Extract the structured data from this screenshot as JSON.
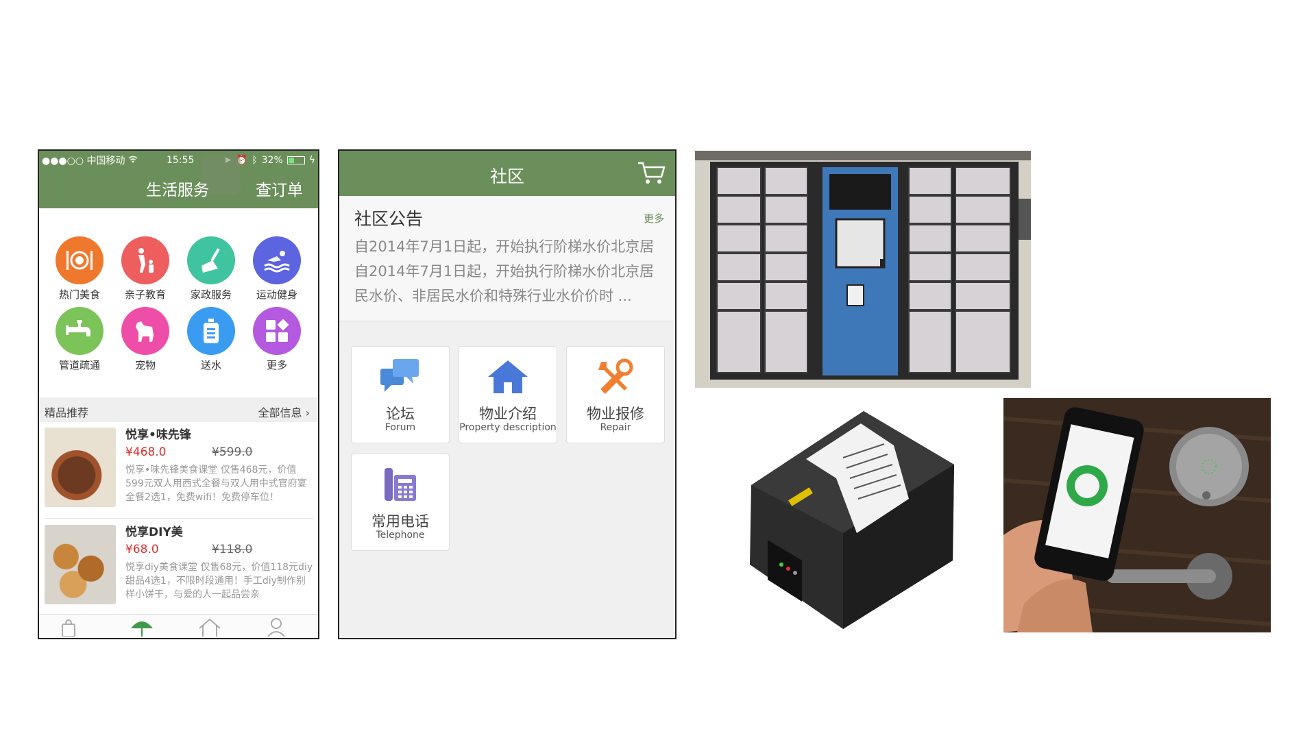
{
  "phone1": {
    "status": {
      "carrier": "●●●○○ 中国移动",
      "time": "15:55",
      "battery": "32%"
    },
    "header": {
      "title": "生活服务",
      "orders": "查订单"
    },
    "services": [
      {
        "label": "热门美食",
        "icon": "food-icon",
        "color": "#f0782c"
      },
      {
        "label": "亲子教育",
        "icon": "parent-child-icon",
        "color": "#ef5e5e"
      },
      {
        "label": "家政服务",
        "icon": "broom-icon",
        "color": "#40c4a0"
      },
      {
        "label": "运动健身",
        "icon": "swim-icon",
        "color": "#5d64e0"
      },
      {
        "label": "管道疏通",
        "icon": "faucet-icon",
        "color": "#7cc45a"
      },
      {
        "label": "宠物",
        "icon": "dog-icon",
        "color": "#ee4ea8"
      },
      {
        "label": "送水",
        "icon": "water-bottle-icon",
        "color": "#3a9cf0"
      },
      {
        "label": "更多",
        "icon": "more-grid-icon",
        "color": "#b45ae0"
      }
    ],
    "recommend": {
      "title": "精品推荐",
      "more": "全部信息"
    },
    "products": [
      {
        "name": "悦享•味先锋",
        "price": "¥468.0",
        "old_price": "¥599.0",
        "desc": "悦享•味先锋美食课堂 仅售468元，价值599元双人用西式全餐与双人用中式官府宴全餐2选1，免费wifi！免费停车位！"
      },
      {
        "name": "悦享DIY美",
        "price": "¥68.0",
        "old_price": "¥118.0",
        "desc": "悦享diy美食课堂 仅售68元，价值118元diy甜品4选1，不限时段通用！手工diy制作别样小饼干，与爱的人一起品尝亲"
      }
    ]
  },
  "phone2": {
    "header": {
      "title": "社区"
    },
    "notice": {
      "title": "社区公告",
      "more": "更多",
      "lines": [
        "自2014年7月1日起，开始执行阶梯水价北京居",
        "自2014年7月1日起，开始执行阶梯水价北京居",
        "民水价、非居民水价和特殊行业水价价时 ..."
      ]
    },
    "tiles": [
      {
        "cn": "论坛",
        "en": "Forum",
        "icon": "forum-chat-icon"
      },
      {
        "cn": "物业介绍",
        "en": "Property description",
        "icon": "house-icon"
      },
      {
        "cn": "物业报修",
        "en": "Repair",
        "icon": "tools-icon"
      },
      {
        "cn": "常用电话",
        "en": "Telephone",
        "icon": "telephone-icon"
      }
    ],
    "accent": "#6b8f5a"
  }
}
